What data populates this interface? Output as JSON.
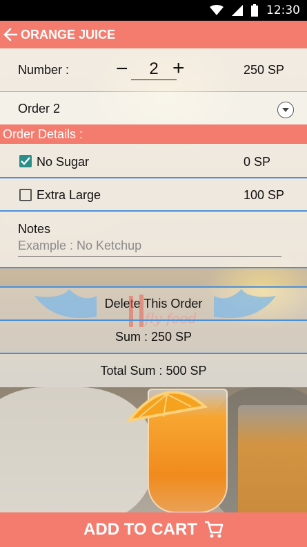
{
  "status_bar": {
    "time": "12:30"
  },
  "app_bar": {
    "title": "ORANGE JUICE"
  },
  "quantity": {
    "label": "Number :",
    "value": "2",
    "price": "250 SP"
  },
  "order_select": {
    "selected": "Order 2"
  },
  "order_details": {
    "header": "Order Details :",
    "options": [
      {
        "label": "No Sugar",
        "price": "0 SP",
        "checked": true
      },
      {
        "label": "Extra Large",
        "price": "100 SP",
        "checked": false
      }
    ]
  },
  "notes": {
    "label": "Notes",
    "placeholder": "Example : No Ketchup"
  },
  "logo_text": "fly food",
  "actions": {
    "delete_label": "Delete This Order"
  },
  "summary": {
    "sum": "Sum : 250 SP",
    "total": "Total Sum : 500 SP"
  },
  "footer": {
    "add_to_cart": "ADD TO CART"
  },
  "colors": {
    "accent": "#f47c6e",
    "divider": "#4a90d9",
    "checkbox": "#2a8f8a"
  }
}
